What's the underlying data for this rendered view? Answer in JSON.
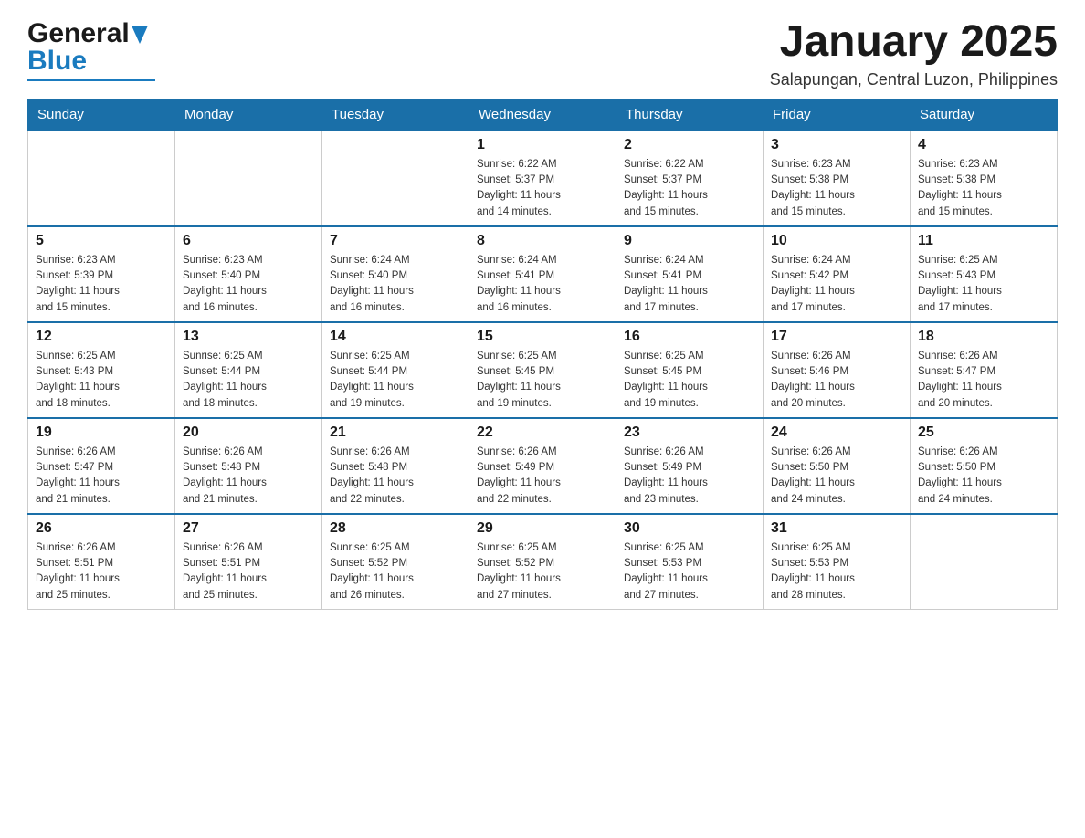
{
  "header": {
    "logo_general": "General",
    "logo_blue": "Blue",
    "month_title": "January 2025",
    "location": "Salapungan, Central Luzon, Philippines"
  },
  "days_of_week": [
    "Sunday",
    "Monday",
    "Tuesday",
    "Wednesday",
    "Thursday",
    "Friday",
    "Saturday"
  ],
  "weeks": [
    [
      {
        "day": "",
        "info": ""
      },
      {
        "day": "",
        "info": ""
      },
      {
        "day": "",
        "info": ""
      },
      {
        "day": "1",
        "info": "Sunrise: 6:22 AM\nSunset: 5:37 PM\nDaylight: 11 hours\nand 14 minutes."
      },
      {
        "day": "2",
        "info": "Sunrise: 6:22 AM\nSunset: 5:37 PM\nDaylight: 11 hours\nand 15 minutes."
      },
      {
        "day": "3",
        "info": "Sunrise: 6:23 AM\nSunset: 5:38 PM\nDaylight: 11 hours\nand 15 minutes."
      },
      {
        "day": "4",
        "info": "Sunrise: 6:23 AM\nSunset: 5:38 PM\nDaylight: 11 hours\nand 15 minutes."
      }
    ],
    [
      {
        "day": "5",
        "info": "Sunrise: 6:23 AM\nSunset: 5:39 PM\nDaylight: 11 hours\nand 15 minutes."
      },
      {
        "day": "6",
        "info": "Sunrise: 6:23 AM\nSunset: 5:40 PM\nDaylight: 11 hours\nand 16 minutes."
      },
      {
        "day": "7",
        "info": "Sunrise: 6:24 AM\nSunset: 5:40 PM\nDaylight: 11 hours\nand 16 minutes."
      },
      {
        "day": "8",
        "info": "Sunrise: 6:24 AM\nSunset: 5:41 PM\nDaylight: 11 hours\nand 16 minutes."
      },
      {
        "day": "9",
        "info": "Sunrise: 6:24 AM\nSunset: 5:41 PM\nDaylight: 11 hours\nand 17 minutes."
      },
      {
        "day": "10",
        "info": "Sunrise: 6:24 AM\nSunset: 5:42 PM\nDaylight: 11 hours\nand 17 minutes."
      },
      {
        "day": "11",
        "info": "Sunrise: 6:25 AM\nSunset: 5:43 PM\nDaylight: 11 hours\nand 17 minutes."
      }
    ],
    [
      {
        "day": "12",
        "info": "Sunrise: 6:25 AM\nSunset: 5:43 PM\nDaylight: 11 hours\nand 18 minutes."
      },
      {
        "day": "13",
        "info": "Sunrise: 6:25 AM\nSunset: 5:44 PM\nDaylight: 11 hours\nand 18 minutes."
      },
      {
        "day": "14",
        "info": "Sunrise: 6:25 AM\nSunset: 5:44 PM\nDaylight: 11 hours\nand 19 minutes."
      },
      {
        "day": "15",
        "info": "Sunrise: 6:25 AM\nSunset: 5:45 PM\nDaylight: 11 hours\nand 19 minutes."
      },
      {
        "day": "16",
        "info": "Sunrise: 6:25 AM\nSunset: 5:45 PM\nDaylight: 11 hours\nand 19 minutes."
      },
      {
        "day": "17",
        "info": "Sunrise: 6:26 AM\nSunset: 5:46 PM\nDaylight: 11 hours\nand 20 minutes."
      },
      {
        "day": "18",
        "info": "Sunrise: 6:26 AM\nSunset: 5:47 PM\nDaylight: 11 hours\nand 20 minutes."
      }
    ],
    [
      {
        "day": "19",
        "info": "Sunrise: 6:26 AM\nSunset: 5:47 PM\nDaylight: 11 hours\nand 21 minutes."
      },
      {
        "day": "20",
        "info": "Sunrise: 6:26 AM\nSunset: 5:48 PM\nDaylight: 11 hours\nand 21 minutes."
      },
      {
        "day": "21",
        "info": "Sunrise: 6:26 AM\nSunset: 5:48 PM\nDaylight: 11 hours\nand 22 minutes."
      },
      {
        "day": "22",
        "info": "Sunrise: 6:26 AM\nSunset: 5:49 PM\nDaylight: 11 hours\nand 22 minutes."
      },
      {
        "day": "23",
        "info": "Sunrise: 6:26 AM\nSunset: 5:49 PM\nDaylight: 11 hours\nand 23 minutes."
      },
      {
        "day": "24",
        "info": "Sunrise: 6:26 AM\nSunset: 5:50 PM\nDaylight: 11 hours\nand 24 minutes."
      },
      {
        "day": "25",
        "info": "Sunrise: 6:26 AM\nSunset: 5:50 PM\nDaylight: 11 hours\nand 24 minutes."
      }
    ],
    [
      {
        "day": "26",
        "info": "Sunrise: 6:26 AM\nSunset: 5:51 PM\nDaylight: 11 hours\nand 25 minutes."
      },
      {
        "day": "27",
        "info": "Sunrise: 6:26 AM\nSunset: 5:51 PM\nDaylight: 11 hours\nand 25 minutes."
      },
      {
        "day": "28",
        "info": "Sunrise: 6:25 AM\nSunset: 5:52 PM\nDaylight: 11 hours\nand 26 minutes."
      },
      {
        "day": "29",
        "info": "Sunrise: 6:25 AM\nSunset: 5:52 PM\nDaylight: 11 hours\nand 27 minutes."
      },
      {
        "day": "30",
        "info": "Sunrise: 6:25 AM\nSunset: 5:53 PM\nDaylight: 11 hours\nand 27 minutes."
      },
      {
        "day": "31",
        "info": "Sunrise: 6:25 AM\nSunset: 5:53 PM\nDaylight: 11 hours\nand 28 minutes."
      },
      {
        "day": "",
        "info": ""
      }
    ]
  ]
}
